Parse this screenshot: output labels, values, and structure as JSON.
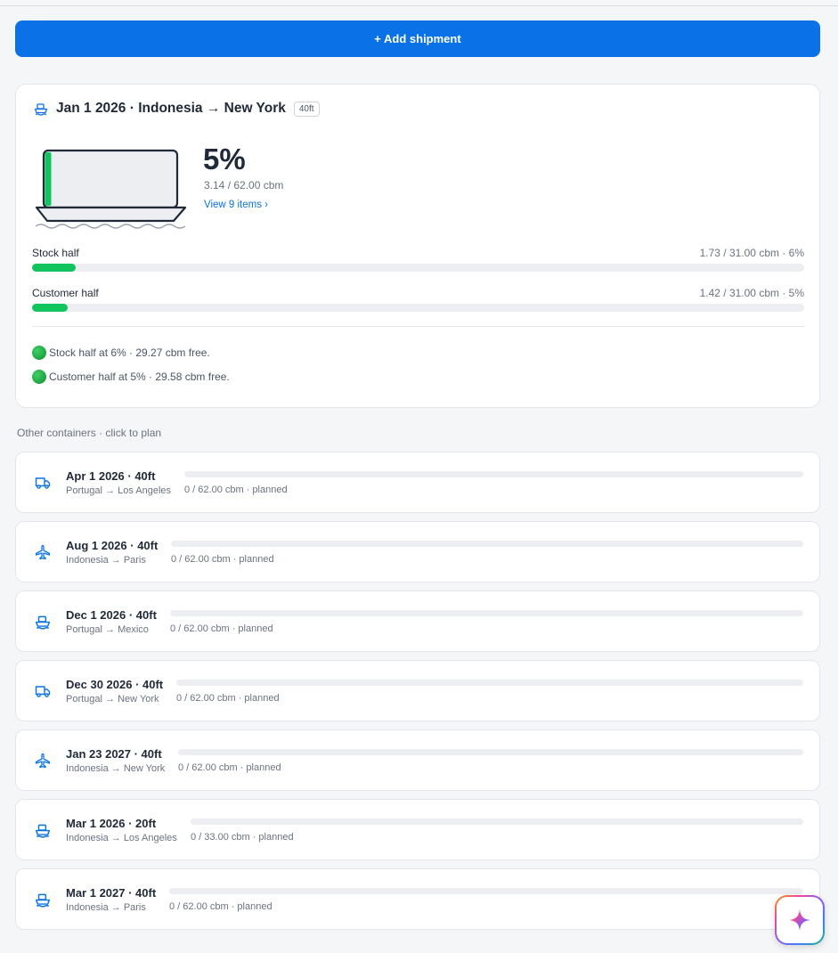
{
  "add_button_label": "+ Add shipment",
  "active": {
    "title": "Jan 1 2026 · Indonesia → New York",
    "badge": "40ft",
    "percent": "5%",
    "cbm": "3.14 / 62.00 cbm",
    "view_link": "View 9 items ›",
    "halves": [
      {
        "label": "Stock half",
        "stat": "1.73 / 31.00 cbm · 6%",
        "fill_pct": 5.6
      },
      {
        "label": "Customer half",
        "stat": "1.42 / 31.00 cbm · 5%",
        "fill_pct": 4.6
      }
    ],
    "notes": [
      "Stock half at 6% · 29.27 cbm free.",
      "Customer half at 5% · 29.58 cbm free."
    ]
  },
  "others_label": "Other containers · click to plan",
  "containers": [
    {
      "title": "Apr 1 2026 · 40ft",
      "route": "Portugal → Los Angeles",
      "stat": "0 / 62.00 cbm · planned",
      "mode": "truck-icon"
    },
    {
      "title": "Aug 1 2026 · 40ft",
      "route": "Indonesia → Paris",
      "stat": "0 / 62.00 cbm · planned",
      "mode": "plane-icon"
    },
    {
      "title": "Dec 1 2026 · 40ft",
      "route": "Portugal → Mexico",
      "stat": "0 / 62.00 cbm · planned",
      "mode": "ship-icon"
    },
    {
      "title": "Dec 30 2026 · 40ft",
      "route": "Portugal → New York",
      "stat": "0 / 62.00 cbm · planned",
      "mode": "truck-icon"
    },
    {
      "title": "Jan 23 2027 · 40ft",
      "route": "Indonesia → New York",
      "stat": "0 / 62.00 cbm · planned",
      "mode": "plane-icon"
    },
    {
      "title": "Mar 1 2026 · 20ft",
      "route": "Indonesia → Los Angeles",
      "stat": "0 / 33.00 cbm · planned",
      "mode": "ship-icon"
    },
    {
      "title": "Mar 1 2027 · 40ft",
      "route": "Indonesia → Paris",
      "stat": "0 / 62.00 cbm · planned",
      "mode": "ship-icon"
    }
  ],
  "colors": {
    "accent": "#0a72e6",
    "fill": "#12c45e"
  }
}
